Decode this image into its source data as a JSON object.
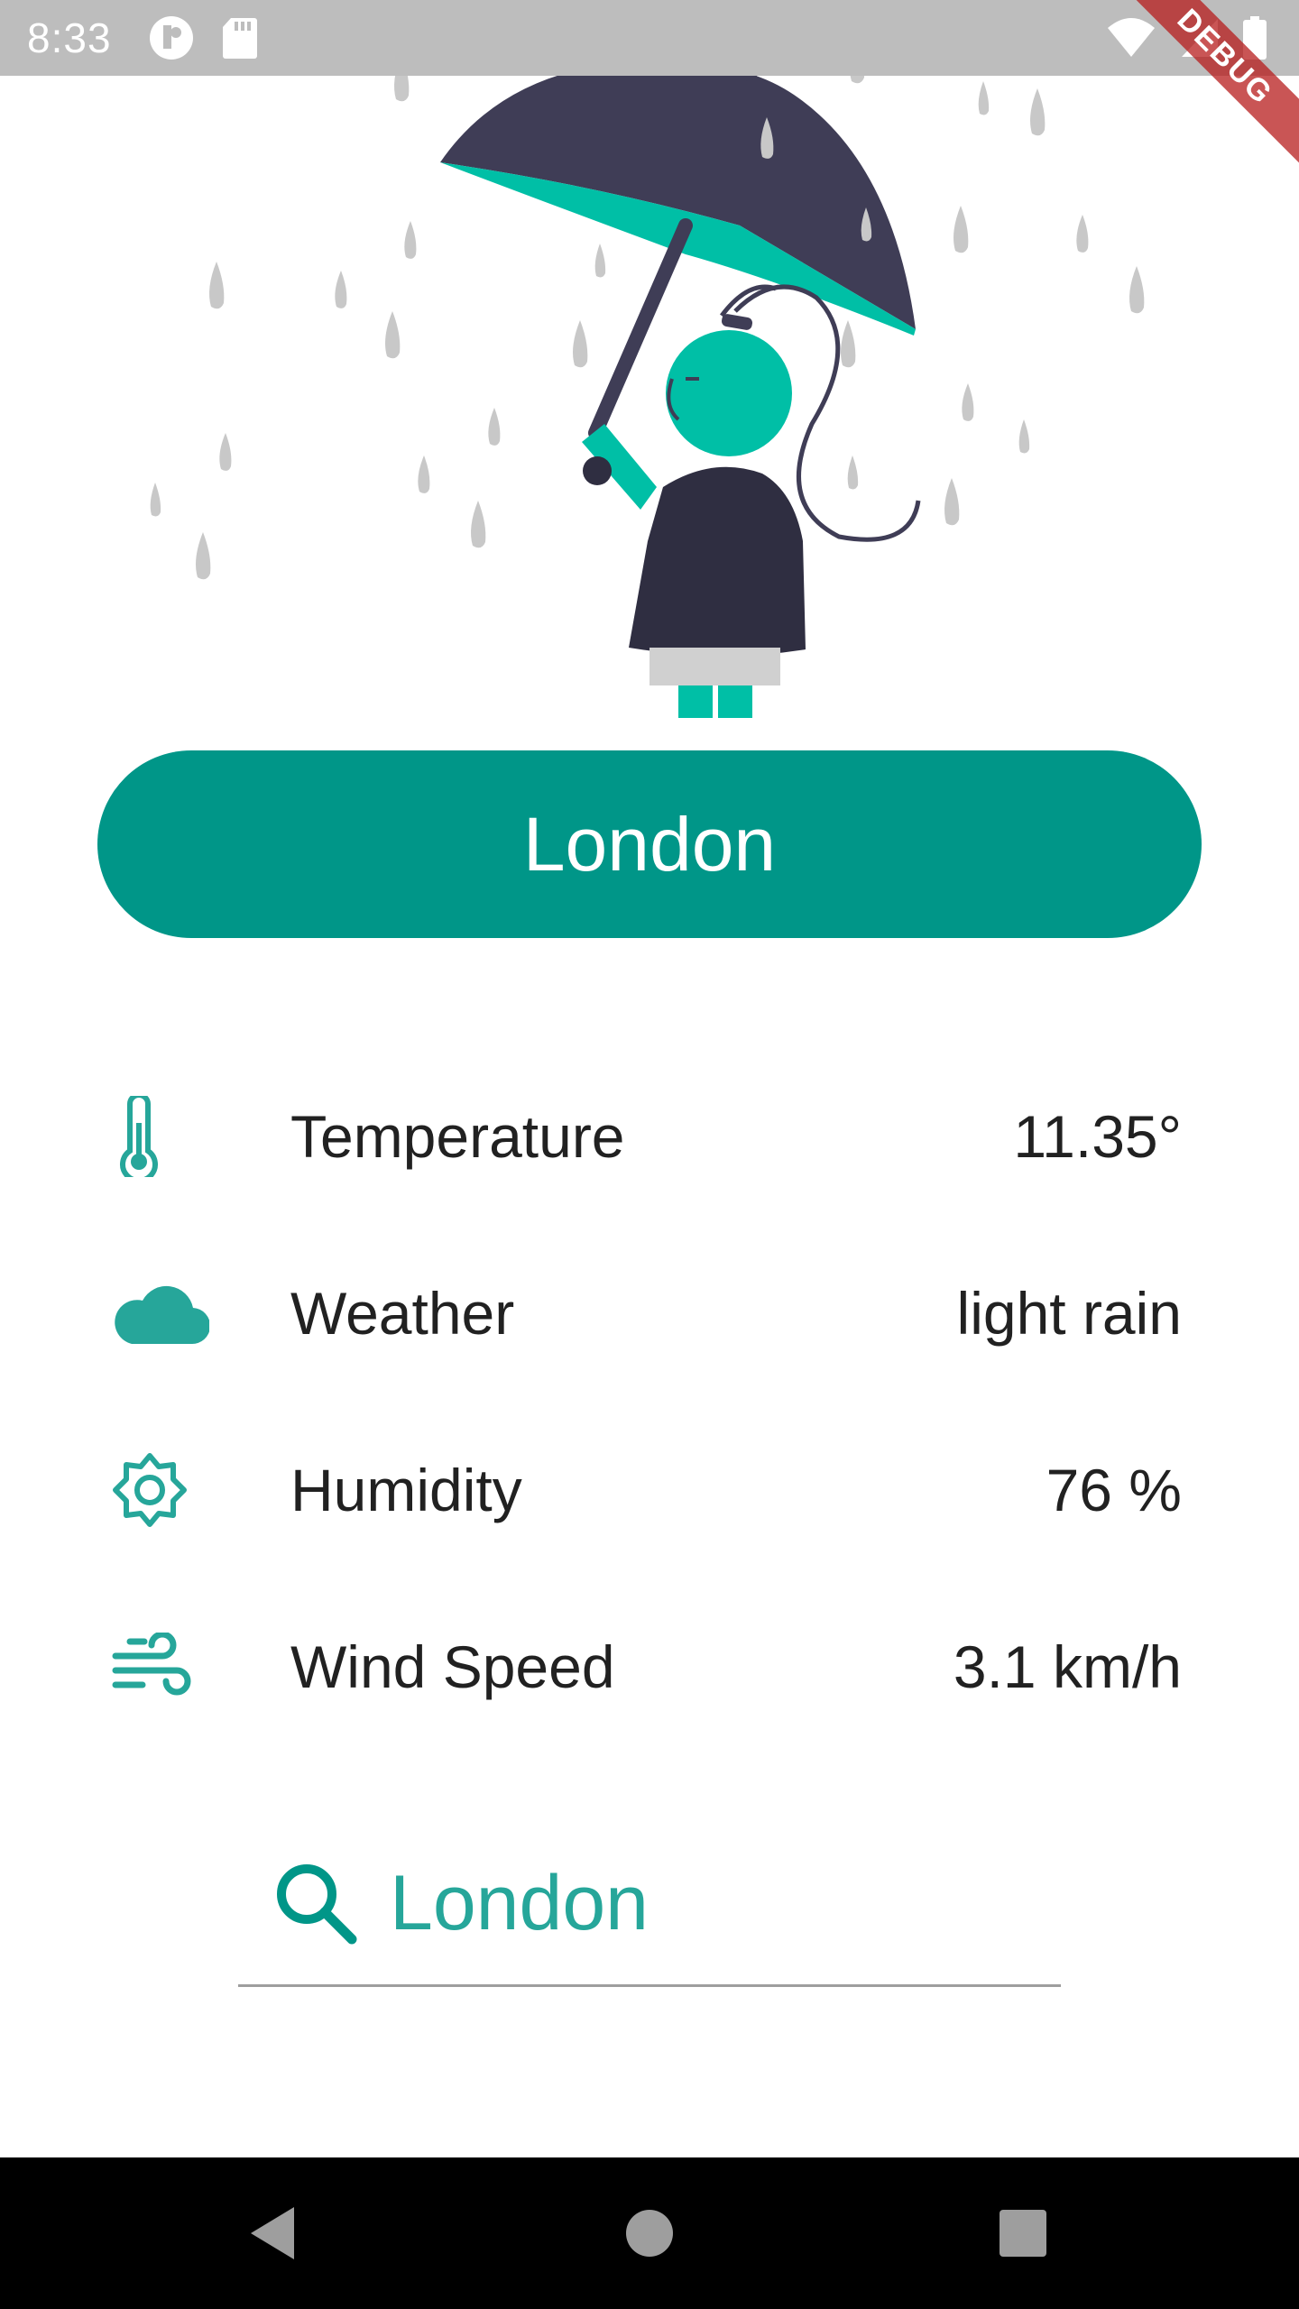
{
  "status_bar": {
    "time": "8:33",
    "left_icons": [
      "notification-app-icon",
      "sd-card-icon"
    ],
    "right_icons": [
      "wifi-icon",
      "cellular-signal-icon",
      "battery-icon"
    ]
  },
  "debug_banner": {
    "label": "DEBUG",
    "color": "#b71c1c"
  },
  "illustration": {
    "name": "person-with-umbrella-in-rain",
    "colors": {
      "umbrella": "#3f3d56",
      "accent": "#00bfa6",
      "raindrop": "#cfcfcf"
    }
  },
  "city_button": {
    "label": "London",
    "color": "#009688"
  },
  "weather_info": [
    {
      "icon": "thermometer-icon",
      "label": "Temperature",
      "value": "11.35°"
    },
    {
      "icon": "cloud-icon",
      "label": "Weather",
      "value": "light rain"
    },
    {
      "icon": "sun-gear-icon",
      "label": "Humidity",
      "value": "76 %"
    },
    {
      "icon": "wind-icon",
      "label": "Wind Speed",
      "value": "3.1 km/h"
    }
  ],
  "search": {
    "icon": "search-icon",
    "value": "London",
    "text_color": "#26a69a"
  },
  "nav_bar": {
    "buttons": [
      "back-icon",
      "home-icon",
      "recents-icon"
    ]
  },
  "colors": {
    "primary": "#009688",
    "icon_teal": "#26a69a",
    "text": "#212121"
  }
}
